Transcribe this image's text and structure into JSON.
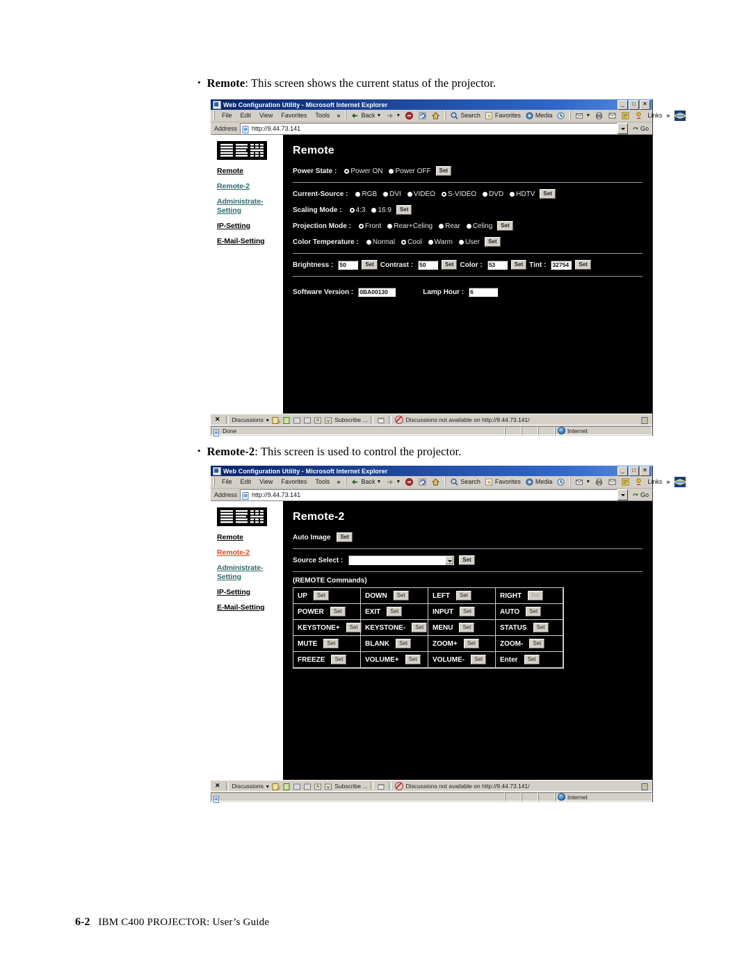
{
  "document": {
    "bullets": [
      {
        "term": "Remote",
        "rest": ": This screen shows the current status of the projector."
      },
      {
        "term": "Remote-2",
        "rest": ": This screen is used to control the projector."
      }
    ],
    "footer": {
      "page_number": "6-2",
      "text": "IBM C400 PROJECTOR: User’s Guide"
    }
  },
  "browser": {
    "title": "Web Configuration Utility - Microsoft Internet Explorer",
    "window_buttons": {
      "minimize": "_",
      "restore": "□",
      "close": "✕"
    },
    "menu": [
      "File",
      "Edit",
      "View",
      "Favorites",
      "Tools"
    ],
    "menu_overflow": "»",
    "toolbar": {
      "back": "Back",
      "forward": "→",
      "stop": "stop-icon",
      "refresh": "refresh-icon",
      "home": "home-icon",
      "search": "Search",
      "favorites": "Favorites",
      "media": "Media",
      "history": "history-icon",
      "mail": "mail-icon",
      "print": "print-icon",
      "edit": "edit-icon",
      "discuss": "discuss-icon",
      "messenger": "messenger-icon",
      "links_label": "Links",
      "links_overflow": "»"
    },
    "address": {
      "label": "Address",
      "url": "http://9.44.73.141",
      "go_label": "Go"
    },
    "discussions": {
      "close": "✕",
      "menu_label": "Discussions",
      "subscribe_label": "Subscribe ...",
      "message": "Discussions not available on http://9.44.73.141/"
    },
    "statusbar": {
      "done_text": "Done",
      "zone": "Internet"
    }
  },
  "sidebar": {
    "logo_alt": "IBM",
    "items": [
      {
        "label": "Remote",
        "state": "black"
      },
      {
        "label": "Remote-2",
        "state": "teal"
      },
      {
        "label": "Administrate-Setting",
        "state": "teal"
      },
      {
        "label": "IP-Setting",
        "state": "black"
      },
      {
        "label": "E-Mail-Setting",
        "state": "black"
      }
    ],
    "items_window2": [
      {
        "label": "Remote",
        "state": "black"
      },
      {
        "label": "Remote-2",
        "state": "red"
      },
      {
        "label": "Administrate-Setting",
        "state": "teal"
      },
      {
        "label": "IP-Setting",
        "state": "black"
      },
      {
        "label": "E-Mail-Setting",
        "state": "black"
      }
    ]
  },
  "remote_page": {
    "title": "Remote",
    "set_label": "Set",
    "power_state": {
      "label": "Power State :",
      "options": [
        "Power ON",
        "Power OFF"
      ],
      "selected": "Power ON"
    },
    "current_source": {
      "label": "Current-Source :",
      "options": [
        "RGB",
        "DVI",
        "VIDEO",
        "S-VIDEO",
        "DVD",
        "HDTV"
      ],
      "selected": "S-VIDEO"
    },
    "scaling_mode": {
      "label": "Scaling Mode :",
      "options": [
        "4:3",
        "16:9"
      ],
      "selected": "4:3"
    },
    "projection_mode": {
      "label": "Projection Mode :",
      "options": [
        "Front",
        "Rear+Celing",
        "Rear",
        "Celing"
      ],
      "selected": "Front"
    },
    "color_temperature": {
      "label": "Color Temperature :",
      "options": [
        "Normal",
        "Cool",
        "Warm",
        "User"
      ],
      "selected": "Cool"
    },
    "adjustments": [
      {
        "label": "Brightness :",
        "value": "50"
      },
      {
        "label": "Contrast :",
        "value": "50"
      },
      {
        "label": "Color :",
        "value": "53"
      },
      {
        "label": "Tint :",
        "value": "32754"
      }
    ],
    "info": [
      {
        "label": "Software Version :",
        "value": "0BA00130"
      },
      {
        "label": "Lamp Hour :",
        "value": "6"
      }
    ]
  },
  "remote2_page": {
    "title": "Remote-2",
    "set_label": "Set",
    "auto_image": {
      "label": "Auto Image"
    },
    "source_select": {
      "label": "Source Select :",
      "value": ""
    },
    "commands_group_title": "(REMOTE Commands)",
    "commands": [
      [
        "UP",
        "DOWN",
        "LEFT",
        "RIGHT"
      ],
      [
        "POWER",
        "EXIT",
        "INPUT",
        "AUTO"
      ],
      [
        "KEYSTONE+",
        "KEYSTONE-",
        "MENU",
        "STATUS"
      ],
      [
        "MUTE",
        "BLANK",
        "ZOOM+",
        "ZOOM-"
      ],
      [
        "FREEZE",
        "VOLUME+",
        "VOLUME-",
        "Enter"
      ]
    ]
  },
  "colors": {
    "page_background": "#000000",
    "sidebar_background": "#ffffff",
    "link_teal": "#2e6b6b",
    "link_red": "#e8431f",
    "chrome": "#d4d0c8",
    "titlebar": "#0a246a"
  }
}
